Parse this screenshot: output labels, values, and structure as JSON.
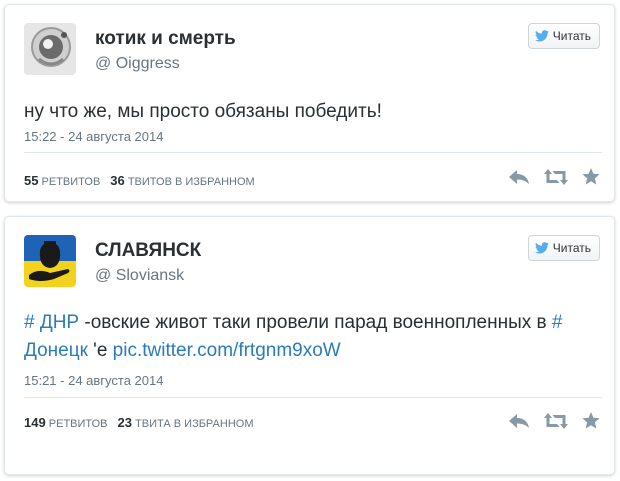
{
  "colors": {
    "link": "#2b7bb9",
    "name": "#292f33",
    "muted": "#66757f",
    "icon": "#8899a6",
    "bird": "#55acee"
  },
  "tweets": [
    {
      "name": "котик и смерть",
      "handle": "@ Oiggress",
      "follow_label": "Читать",
      "text": "ну что же, мы просто обязаны победить!",
      "timestamp": "15:22 - 24 августа 2014",
      "retweets_count": "55",
      "retweets_label": "РЕТВИТОВ",
      "favorites_count": "36",
      "favorites_label": "ТВИТОВ В ИЗБРАННОМ"
    },
    {
      "name": "СЛАВЯНСК",
      "handle": "@ Sloviansk",
      "follow_label": "Читать",
      "text_hashtag1": "# ДНР",
      "text_part1": " -овские живот таки провели парад военнопленных в ",
      "text_hashtag2": "# Донецк",
      "text_part2": " 'е ",
      "text_link": "pic.twitter.com/frtgnm9xoW",
      "timestamp": "15:21 - 24 августа 2014",
      "retweets_count": "149",
      "retweets_label": "РЕТВИТОВ",
      "favorites_count": "23",
      "favorites_label": "ТВИТА В ИЗБРАННОМ"
    }
  ]
}
